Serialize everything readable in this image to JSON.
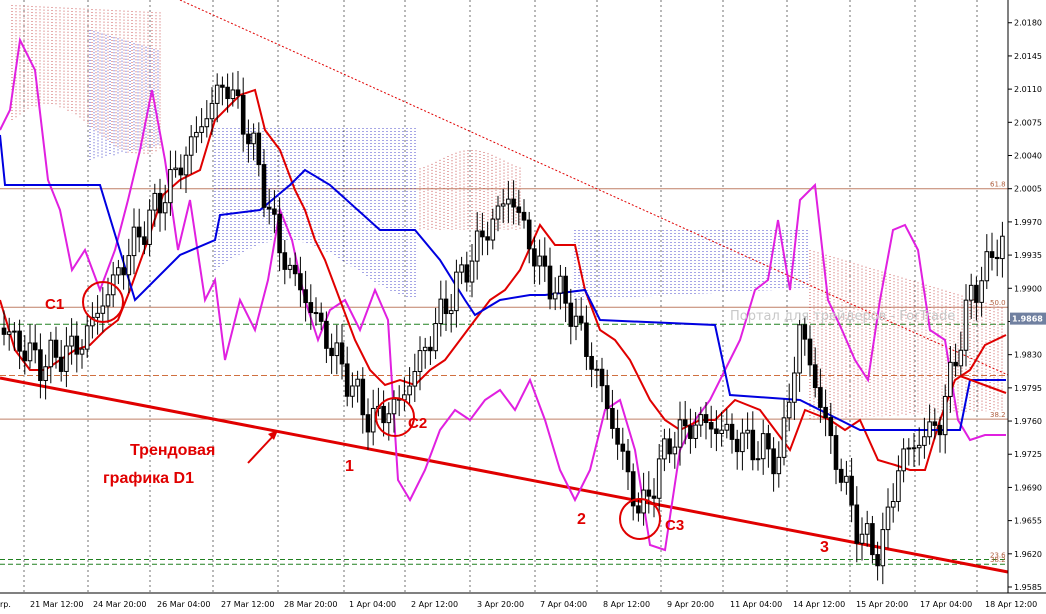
{
  "chart_data": {
    "type": "candlestick",
    "y_range": [
      1.9585,
      2.0185
    ],
    "y_ticks": [
      "2.0180",
      "2.0145",
      "2.0110",
      "2.0075",
      "2.0040",
      "2.0005",
      "1.9970",
      "1.9935",
      "1.9900",
      "1.9865",
      "1.9830",
      "1.9795",
      "1.9760",
      "1.9725",
      "1.9690",
      "1.9655",
      "1.9620",
      "1.9585"
    ],
    "x_ticks": [
      "rp.",
      "21 Mar 12:00",
      "24 Mar 20:00",
      "26 Mar 04:00",
      "27 Mar 12:00",
      "28 Mar 20:00",
      "1 Apr 04:00",
      "2 Apr 12:00",
      "3 Apr 20:00",
      "7 Apr 04:00",
      "8 Apr 12:00",
      "9 Apr 20:00",
      "11 Apr 04:00",
      "14 Apr 12:00",
      "15 Apr 20:00",
      "17 Apr 04:00",
      "18 Apr 12:00"
    ],
    "current_price": "1.9868",
    "fib_levels": [
      {
        "label": "61.8",
        "price": 2.0005
      },
      {
        "label": "50.0",
        "price": 1.988
      },
      {
        "label": "38.2",
        "price": 1.9762
      },
      {
        "label": "23.6",
        "price": 1.9614
      },
      {
        "label": "38.2",
        "price": 1.9609
      }
    ],
    "watermark": "Портал для трейдеров - ForTrade",
    "annotations": {
      "c1": "C1",
      "c2": "C2",
      "c3": "C3",
      "w1": "1",
      "w2": "2",
      "w3": "3",
      "trend_line1": "Трендовая",
      "trend_line2": "графика D1"
    },
    "colors": {
      "bull": "#ffffff",
      "bear": "#000000",
      "red": "#e00000",
      "blue": "#0000e0",
      "magenta": "#e020e0",
      "cloud": "#2020c0",
      "cloud_red": "#c03030",
      "fib": "#b06040",
      "dashed_green": "#208020",
      "annotation": "#e00000",
      "price_box": "#7080a0"
    }
  }
}
